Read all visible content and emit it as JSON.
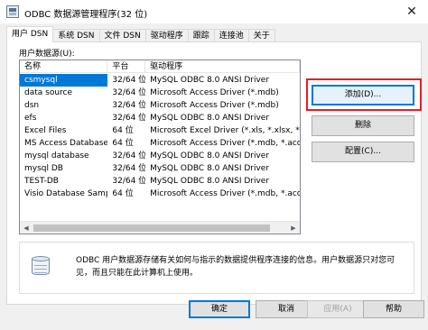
{
  "window": {
    "title": "ODBC 数据源管理程序(32 位)",
    "close": "✕"
  },
  "tabs": [
    {
      "label": "用户 DSN",
      "active": true
    },
    {
      "label": "系统 DSN",
      "active": false
    },
    {
      "label": "文件 DSN",
      "active": false
    },
    {
      "label": "驱动程序",
      "active": false
    },
    {
      "label": "跟踪",
      "active": false
    },
    {
      "label": "连接池",
      "active": false
    },
    {
      "label": "关于",
      "active": false
    }
  ],
  "user_dsn": {
    "list_label": "用户数据源(U):",
    "columns": [
      "名称",
      "平台",
      "驱动程序"
    ],
    "rows": [
      {
        "name": "csmysql",
        "platform": "32/64 位",
        "driver": "MySQL ODBC 8.0 ANSI Driver",
        "selected": true
      },
      {
        "name": "data source",
        "platform": "32/64 位",
        "driver": "Microsoft Access Driver (*.mdb)",
        "selected": false
      },
      {
        "name": "dsn",
        "platform": "32/64 位",
        "driver": "Microsoft Access Driver (*.mdb)",
        "selected": false
      },
      {
        "name": "efs",
        "platform": "32/64 位",
        "driver": "MySQL ODBC 8.0 ANSI Driver",
        "selected": false
      },
      {
        "name": "Excel Files",
        "platform": "64 位",
        "driver": "Microsoft Excel Driver (*.xls, *.xlsx, *.xlsm,",
        "selected": false
      },
      {
        "name": "MS Access Database",
        "platform": "64 位",
        "driver": "Microsoft Access Driver (*.mdb, *.accdb)",
        "selected": false
      },
      {
        "name": "mysql database",
        "platform": "32/64 位",
        "driver": "MySQL ODBC 8.0 ANSI Driver",
        "selected": false
      },
      {
        "name": "mysql DB",
        "platform": "32/64 位",
        "driver": "MySQL ODBC 8.0 ANSI Driver",
        "selected": false
      },
      {
        "name": "TEST-DB",
        "platform": "32/64 位",
        "driver": "MySQL ODBC 8.0 ANSI Driver",
        "selected": false
      },
      {
        "name": "Visio Database Samples",
        "platform": "64 位",
        "driver": "Microsoft Access Driver (*.mdb, *.accdb)",
        "selected": false
      }
    ],
    "buttons": {
      "add": "添加(D)...",
      "delete": "删除",
      "configure": "配置(C)..."
    },
    "info_text": "ODBC 用户数据源存储有关如何与指示的数据提供程序连接的信息。用户数据源只对您可见，而且只能在此计算机上使用。"
  },
  "dialog_buttons": {
    "ok": "确定",
    "cancel": "取消",
    "apply": "应用(A)",
    "help": "帮助"
  },
  "colors": {
    "selection": "#0078d7",
    "highlight_box": "#e0202a"
  }
}
